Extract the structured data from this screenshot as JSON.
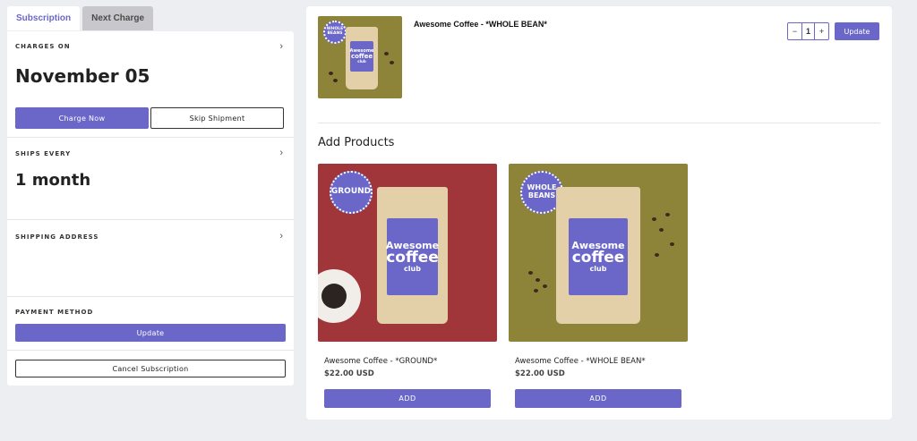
{
  "tabs": [
    {
      "label": "Subscription",
      "active": true
    },
    {
      "label": "Next Charge",
      "active": false
    }
  ],
  "charges_on": {
    "label": "CHARGES ON",
    "value": "November 05"
  },
  "actions": {
    "charge_now": "Charge Now",
    "skip_shipment": "Skip Shipment"
  },
  "ships_every": {
    "label": "SHIPS EVERY",
    "value": "1 month"
  },
  "shipping_address": {
    "label": "SHIPPING ADDRESS"
  },
  "payment_method": {
    "label": "PAYMENT METHOD",
    "update": "Update"
  },
  "cancel": "Cancel Subscription",
  "current_item": {
    "title": "Awesome Coffee - *WHOLE BEAN*",
    "badge": "WHOLE BEANS",
    "quantity": "1",
    "minus": "−",
    "plus": "+",
    "update": "Update"
  },
  "add_products": {
    "title": "Add Products",
    "products": [
      {
        "name": "Awesome Coffee - *GROUND*",
        "price": "$22.00 USD",
        "add": "ADD",
        "badge": "GROUND",
        "bg": "#a0353a"
      },
      {
        "name": "Awesome Coffee - *WHOLE BEAN*",
        "price": "$22.00 USD",
        "add": "ADD",
        "badge": "WHOLE BEANS",
        "bg": "#8e8439"
      }
    ]
  },
  "bag_label": {
    "line1": "Awesome",
    "line2": "coffee",
    "line3": "club"
  },
  "colors": {
    "accent": "#6a67c9",
    "background": "#eceef2"
  },
  "icons": {
    "chevron": "chevron-right-icon"
  }
}
